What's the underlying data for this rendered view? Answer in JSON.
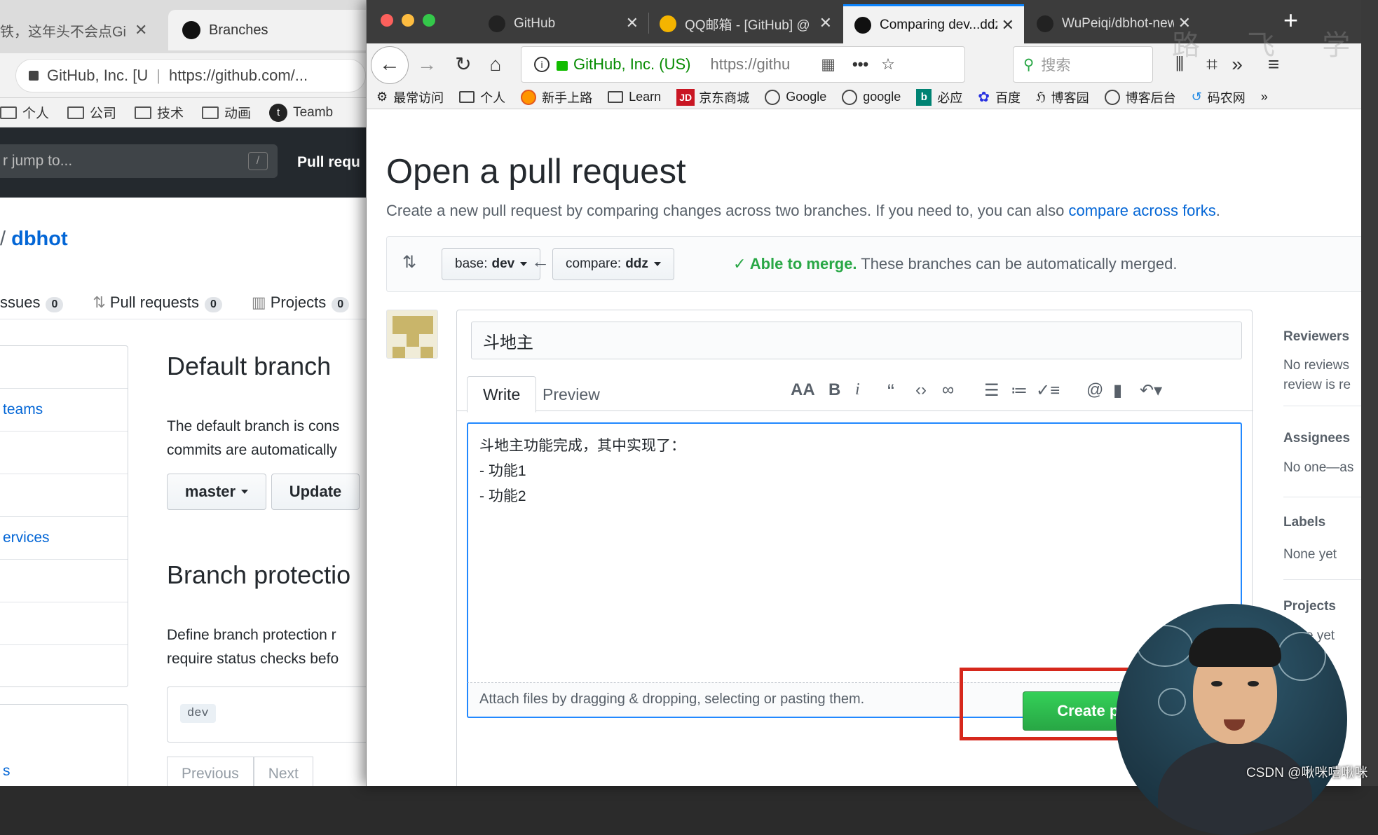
{
  "back_window": {
    "tabs": [
      {
        "title": "铁，这年头不会点Gi",
        "active": false
      },
      {
        "title": "Branches",
        "active": true
      }
    ],
    "url_security": "GitHub, Inc. [U",
    "url": "https://github.com/...",
    "bookmarks": [
      "个人",
      "公司",
      "技术",
      "动画",
      "Teamb"
    ],
    "search_placeholder": "r jump to...",
    "slash_key": "/",
    "nav_label": "Pull requ",
    "repo_slash": "/",
    "repo_name": "dbhot",
    "repo_nav": [
      {
        "label": "ssues",
        "count": "0"
      },
      {
        "label": "Pull requests",
        "count": "0"
      },
      {
        "label": "Projects",
        "count": "0"
      }
    ],
    "side_menu": [
      "",
      "teams",
      "",
      "",
      "ervices",
      "",
      "",
      ""
    ],
    "side_menu_bottom": "s",
    "default_branch_title": "Default branch",
    "default_branch_text_1": "The default branch is cons",
    "default_branch_text_2": "commits are automatically",
    "branch_select": "master",
    "update_button": "Update",
    "branch_protection_title": "Branch protectio",
    "branch_protection_text_1": "Define branch protection r",
    "branch_protection_text_2": "require status checks befo",
    "protected_branch_label": "dev",
    "pager_prev": "Previous",
    "pager_next": "Next"
  },
  "front_window": {
    "tabs": [
      {
        "title": "GitHub",
        "active": false
      },
      {
        "title": "QQ邮箱 - [GitHub] @",
        "active": false
      },
      {
        "title": "Comparing dev...ddz",
        "active": true
      },
      {
        "title": "WuPeiqi/dbhot-new",
        "active": false
      }
    ],
    "url_identity": "GitHub, Inc. (US)",
    "url": "https://githu",
    "search_placeholder": "搜索",
    "bookmarks": [
      "最常访问",
      "个人",
      "新手上路",
      "Learn",
      "京东商城",
      "Google",
      "google",
      "必应",
      "百度",
      "博客园",
      "博客后台",
      "码农网"
    ],
    "jd_badge": "JD",
    "page": {
      "title": "Open a pull request",
      "subtitle": "Create a new pull request by comparing changes across two branches. If you need to, you can also ",
      "subtitle_link": "compare across forks",
      "subtitle_end": ".",
      "base_label": "base:",
      "base_branch": "dev",
      "compare_label": "compare:",
      "compare_branch": "ddz",
      "merge_status": "Able to merge.",
      "merge_text": " These branches can be automatically merged.",
      "pr_title": "斗地主",
      "tab_write": "Write",
      "tab_preview": "Preview",
      "body_text": "斗地主功能完成，其中实现了：\n- 功能1\n- 功能2",
      "attach_text": "Attach files by dragging & dropping, selecting or pasting them.",
      "create_button": "Create pu",
      "sidebar": {
        "reviewers_title": "Reviewers",
        "reviewers_text_1": "No reviews",
        "reviewers_text_2": "review is re",
        "assignees_title": "Assignees",
        "assignees_text": "No one—as",
        "labels_title": "Labels",
        "labels_text": "None yet",
        "projects_title": "Projects",
        "projects_text": "e yet"
      }
    }
  },
  "overlay": {
    "watermark_site": "路 飞 学 城",
    "credit": "CSDN @啾咪嘻啾咪"
  }
}
